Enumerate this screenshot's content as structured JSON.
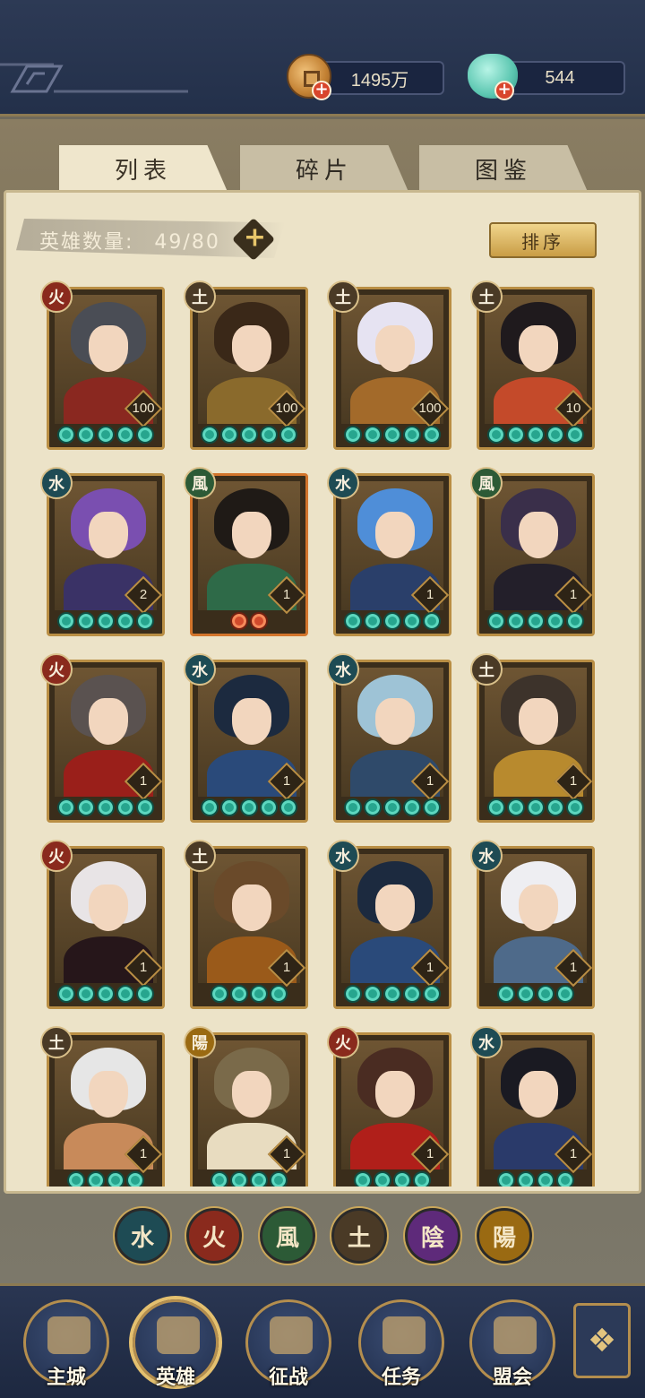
{
  "currency": {
    "gold_value": "1495万",
    "jade_value": "544",
    "add_icon": "+"
  },
  "tabs": [
    {
      "label": "列表",
      "active": true
    },
    {
      "label": "碎片",
      "active": false
    },
    {
      "label": "图鉴",
      "active": false
    }
  ],
  "hero_count": {
    "label": "英雄数量:",
    "value": "49/80",
    "add_icon": "+"
  },
  "sort_label": "排序",
  "elements": {
    "water": "水",
    "fire": "火",
    "wind": "風",
    "earth": "土",
    "yin": "陰",
    "yang": "陽"
  },
  "heroes": [
    {
      "element": "火",
      "el": "fire",
      "level": "100",
      "stars": 5,
      "red": 0,
      "hair": "#4a4d55",
      "body": "#8a2820"
    },
    {
      "element": "土",
      "el": "earth",
      "level": "100",
      "stars": 5,
      "red": 0,
      "hair": "#3a2818",
      "body": "#8a6a2c"
    },
    {
      "element": "土",
      "el": "earth",
      "level": "100",
      "stars": 5,
      "red": 0,
      "hair": "#e6e3f2",
      "body": "#a36a2a"
    },
    {
      "element": "土",
      "el": "earth",
      "level": "10",
      "stars": 5,
      "red": 0,
      "hair": "#1f1a1d",
      "body": "#c44a2a"
    },
    {
      "element": "水",
      "el": "water",
      "level": "2",
      "stars": 5,
      "red": 0,
      "hair": "#7a4fb0",
      "body": "#3a3266"
    },
    {
      "element": "風",
      "el": "wind",
      "level": "1",
      "stars": 0,
      "red": 2,
      "hair": "#1f1a16",
      "body": "#2e6a48"
    },
    {
      "element": "水",
      "el": "water",
      "level": "1",
      "stars": 5,
      "red": 0,
      "hair": "#4f8ed8",
      "body": "#2a3f6a"
    },
    {
      "element": "風",
      "el": "wind",
      "level": "1",
      "stars": 5,
      "red": 0,
      "hair": "#3a2f4a",
      "body": "#231f2a"
    },
    {
      "element": "火",
      "el": "fire",
      "level": "1",
      "stars": 5,
      "red": 0,
      "hair": "#5a5250",
      "body": "#9a1f1a"
    },
    {
      "element": "水",
      "el": "water",
      "level": "1",
      "stars": 5,
      "red": 0,
      "hair": "#1c2a3f",
      "body": "#2a4a7a"
    },
    {
      "element": "水",
      "el": "water",
      "level": "1",
      "stars": 5,
      "red": 0,
      "hair": "#9ec3d6",
      "body": "#2f4a6a"
    },
    {
      "element": "土",
      "el": "earth",
      "level": "1",
      "stars": 5,
      "red": 0,
      "hair": "#3d332b",
      "body": "#b88a2e"
    },
    {
      "element": "火",
      "el": "fire",
      "level": "1",
      "stars": 5,
      "red": 0,
      "hair": "#e8e4e6",
      "body": "#26161a"
    },
    {
      "element": "土",
      "el": "earth",
      "level": "1",
      "stars": 4,
      "red": 0,
      "hair": "#6a4a2a",
      "body": "#9a5a1a"
    },
    {
      "element": "水",
      "el": "water",
      "level": "1",
      "stars": 5,
      "red": 0,
      "hair": "#1c2a3f",
      "body": "#2a4a7a"
    },
    {
      "element": "水",
      "el": "water",
      "level": "1",
      "stars": 4,
      "red": 0,
      "hair": "#eeeef2",
      "body": "#4e6a8a"
    },
    {
      "element": "土",
      "el": "earth",
      "level": "1",
      "stars": 4,
      "red": 0,
      "hair": "#e6e6e6",
      "body": "#c88a5a"
    },
    {
      "element": "陽",
      "el": "yang",
      "level": "1",
      "stars": 4,
      "red": 0,
      "hair": "#7a6a4a",
      "body": "#e8dcc0"
    },
    {
      "element": "火",
      "el": "fire",
      "level": "1",
      "stars": 4,
      "red": 0,
      "hair": "#4a2c22",
      "body": "#b01f1a"
    },
    {
      "element": "水",
      "el": "water",
      "level": "1",
      "stars": 4,
      "red": 0,
      "hair": "#1a1a22",
      "body": "#2a3a6a"
    }
  ],
  "filters": [
    {
      "label": "水",
      "el": "water"
    },
    {
      "label": "火",
      "el": "fire"
    },
    {
      "label": "風",
      "el": "wind"
    },
    {
      "label": "土",
      "el": "earth"
    },
    {
      "label": "陰",
      "el": "yin"
    },
    {
      "label": "陽",
      "el": "yang"
    }
  ],
  "nav": [
    {
      "label": "主城",
      "name": "main-city",
      "active": false
    },
    {
      "label": "英雄",
      "name": "heroes",
      "active": true
    },
    {
      "label": "征战",
      "name": "campaign",
      "active": false
    },
    {
      "label": "任务",
      "name": "tasks",
      "active": false
    },
    {
      "label": "盟会",
      "name": "guild",
      "active": false
    }
  ],
  "menu_icon": "❖"
}
